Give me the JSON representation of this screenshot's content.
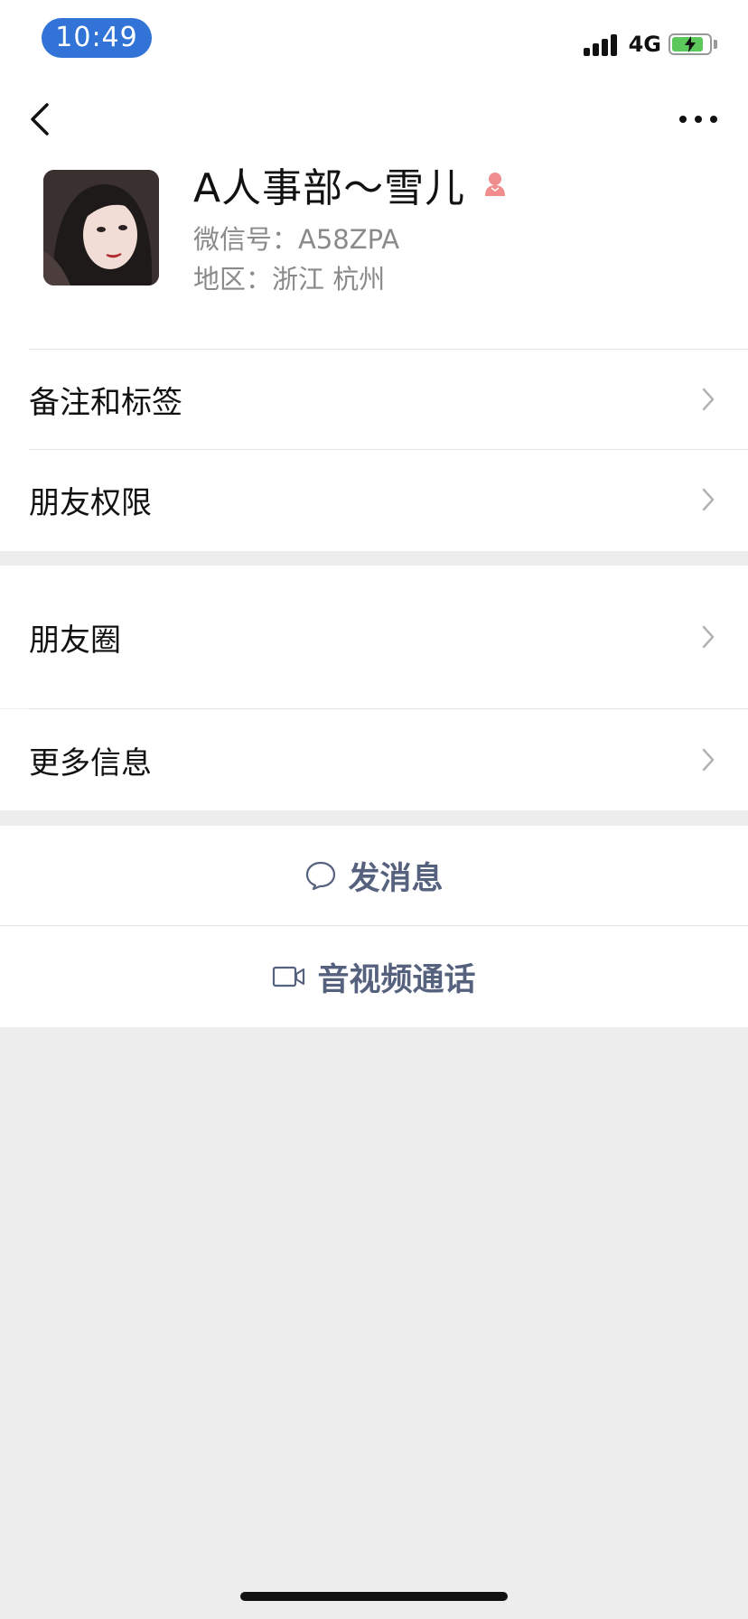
{
  "status_bar": {
    "time": "10:49",
    "network": "4G",
    "battery_charging_icon": "battery-charging-icon"
  },
  "nav": {
    "back_icon": "chevron-left-icon",
    "more_icon": "more-dots-icon"
  },
  "profile": {
    "name": "A人事部～雪儿",
    "gender_icon": "female-icon",
    "wechat_id": "微信号：A58ZPA",
    "region": "地区：浙江 杭州"
  },
  "menu": {
    "remarks_tags": "备注和标签",
    "friend_permissions": "朋友权限",
    "moments": "朋友圈",
    "more_info": "更多信息"
  },
  "actions": {
    "send_message": "发消息",
    "av_call": "音视频通话"
  },
  "colors": {
    "time_pill": "#3273d8",
    "action_text": "#56617e",
    "background": "#ededed",
    "gender": "#f08c8c"
  }
}
